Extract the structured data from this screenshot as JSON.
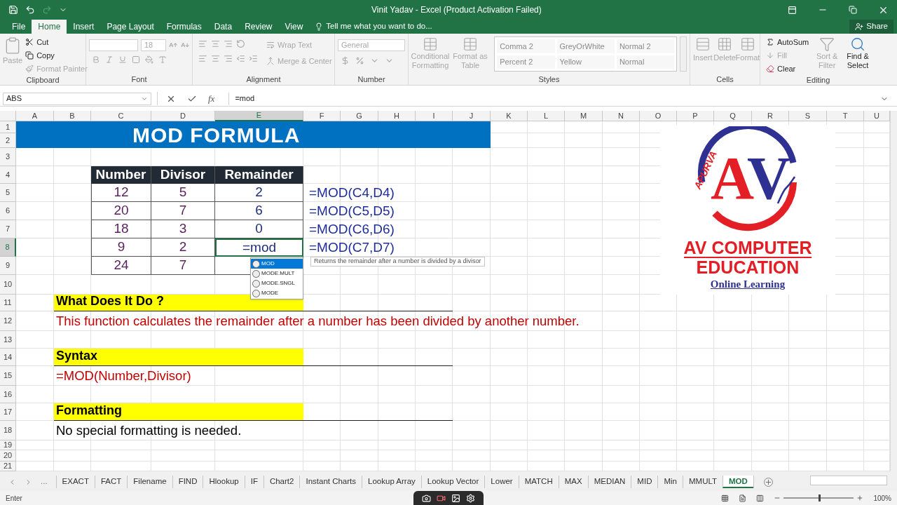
{
  "window": {
    "title": "Vinit Yadav - Excel (Product Activation Failed)"
  },
  "ribbon_tabs": [
    {
      "label": "File",
      "selected": false
    },
    {
      "label": "Home",
      "selected": true
    },
    {
      "label": "Insert",
      "selected": false
    },
    {
      "label": "Page Layout",
      "selected": false
    },
    {
      "label": "Formulas",
      "selected": false
    },
    {
      "label": "Data",
      "selected": false
    },
    {
      "label": "Review",
      "selected": false
    },
    {
      "label": "View",
      "selected": false
    }
  ],
  "tell_me": "Tell me what you want to do...",
  "share": "Share",
  "ribbon": {
    "clipboard": {
      "label": "Clipboard",
      "items": [
        {
          "label": "Paste",
          "disabled": true
        },
        {
          "label": "Cut",
          "disabled": false
        },
        {
          "label": "Copy",
          "disabled": false
        },
        {
          "label": "Format Painter",
          "disabled": true
        }
      ]
    },
    "font": {
      "label": "Font",
      "size": "18"
    },
    "alignment": {
      "label": "Alignment",
      "items": [
        {
          "label": "Wrap Text",
          "disabled": true
        },
        {
          "label": "Merge & Center",
          "disabled": true
        }
      ]
    },
    "number": {
      "label": "Number",
      "format": "General"
    },
    "styles": {
      "label": "Styles",
      "items": [
        {
          "label": "Conditional Formatting",
          "disabled": true
        },
        {
          "label": "Format as Table",
          "disabled": true
        }
      ],
      "gallery": [
        "Comma 2",
        "GreyOrWhite",
        "Normal 2",
        "Percent 2",
        "Yellow",
        "Normal"
      ]
    },
    "cells": {
      "label": "Cells",
      "items": [
        {
          "label": "Insert",
          "disabled": true
        },
        {
          "label": "Delete",
          "disabled": true
        },
        {
          "label": "Format",
          "disabled": true
        }
      ]
    },
    "editing": {
      "label": "Editing",
      "items": [
        {
          "label": "AutoSum",
          "disabled": false
        },
        {
          "label": "Fill",
          "disabled": true
        },
        {
          "label": "Clear",
          "disabled": false
        },
        {
          "label": "Sort & Filter",
          "disabled": true
        },
        {
          "label": "Find & Select",
          "disabled": false
        }
      ]
    }
  },
  "formula_bar": {
    "name_box": "ABS",
    "fx": "fx",
    "formula": "=mod"
  },
  "columns": [
    {
      "label": "A",
      "selected": false
    },
    {
      "label": "B",
      "selected": false
    },
    {
      "label": "C",
      "selected": false
    },
    {
      "label": "D",
      "selected": false
    },
    {
      "label": "E",
      "selected": true
    },
    {
      "label": "F",
      "selected": false
    },
    {
      "label": "G",
      "selected": false
    },
    {
      "label": "H",
      "selected": false
    },
    {
      "label": "I",
      "selected": false
    },
    {
      "label": "J",
      "selected": false
    },
    {
      "label": "K",
      "selected": false
    },
    {
      "label": "L",
      "selected": false
    },
    {
      "label": "M",
      "selected": false
    },
    {
      "label": "N",
      "selected": false
    },
    {
      "label": "O",
      "selected": false
    },
    {
      "label": "P",
      "selected": false
    },
    {
      "label": "Q",
      "selected": false
    },
    {
      "label": "R",
      "selected": false
    },
    {
      "label": "S",
      "selected": false
    },
    {
      "label": "T",
      "selected": false
    },
    {
      "label": "U",
      "selected": false
    }
  ],
  "rows": [
    {
      "label": "1",
      "selected": false
    },
    {
      "label": "2",
      "selected": false
    },
    {
      "label": "3",
      "selected": false
    },
    {
      "label": "4",
      "selected": false
    },
    {
      "label": "5",
      "selected": false
    },
    {
      "label": "6",
      "selected": false
    },
    {
      "label": "7",
      "selected": false
    },
    {
      "label": "8",
      "selected": true
    },
    {
      "label": "9",
      "selected": false
    },
    {
      "label": "10",
      "selected": false
    },
    {
      "label": "11",
      "selected": false
    },
    {
      "label": "12",
      "selected": false
    },
    {
      "label": "13",
      "selected": false
    },
    {
      "label": "14",
      "selected": false
    },
    {
      "label": "15",
      "selected": false
    },
    {
      "label": "16",
      "selected": false
    },
    {
      "label": "17",
      "selected": false
    },
    {
      "label": "18",
      "selected": false
    },
    {
      "label": "19",
      "selected": false
    },
    {
      "label": "20",
      "selected": false
    },
    {
      "label": "21",
      "selected": false
    }
  ],
  "sheet": {
    "title": "MOD FORMULA",
    "table": {
      "columns": [
        "Number",
        "Divisor",
        "Remainder"
      ],
      "rows": [
        {
          "number": "12",
          "divisor": "5",
          "remainder": "2",
          "active": false
        },
        {
          "number": "20",
          "divisor": "7",
          "remainder": "6",
          "active": false
        },
        {
          "number": "18",
          "divisor": "3",
          "remainder": "0",
          "active": false
        },
        {
          "number": "9",
          "divisor": "2",
          "remainder": "=mod",
          "active": true
        },
        {
          "number": "24",
          "divisor": "7",
          "active": false
        }
      ]
    },
    "formulas": [
      "=MOD(C4,D4)",
      "=MOD(C5,D5)",
      "=MOD(C6,D6)",
      "=MOD(C7,D7)"
    ],
    "autocomplete": [
      {
        "label": "MOD",
        "selected": true
      },
      {
        "label": "MODE.MULT",
        "selected": false
      },
      {
        "label": "MODE.SNGL",
        "selected": false
      },
      {
        "label": "MODE",
        "selected": false
      }
    ],
    "tooltip": "Returns the remainder after a number is divided by a divisor",
    "sections": [
      {
        "heading": "What Does It Do ?",
        "body": "This function calculates the remainder after a number has been divided by another number.",
        "color": "#c00000"
      },
      {
        "heading": "Syntax",
        "body": "=MOD(Number,Divisor)",
        "color": "#c00000"
      },
      {
        "heading": "Formatting",
        "body": "No special formatting is needed.",
        "color": "#000000"
      }
    ],
    "logo": {
      "left": "A",
      "right": "V",
      "arc_text": "APURVA",
      "line1": "AV COMPUTER",
      "line2": "EDUCATION",
      "tagline": "Online Learning"
    }
  },
  "sheet_tabs": {
    "more": "...",
    "tabs": [
      {
        "label": "EXACT",
        "selected": false
      },
      {
        "label": "FACT",
        "selected": false
      },
      {
        "label": "Filename",
        "selected": false
      },
      {
        "label": "FIND",
        "selected": false
      },
      {
        "label": "Hlookup",
        "selected": false
      },
      {
        "label": "IF",
        "selected": false
      },
      {
        "label": "Chart2",
        "selected": false
      },
      {
        "label": "Instant Charts",
        "selected": false
      },
      {
        "label": "Lookup Array",
        "selected": false
      },
      {
        "label": "Lookup Vector",
        "selected": false
      },
      {
        "label": "Lower",
        "selected": false
      },
      {
        "label": "MATCH",
        "selected": false
      },
      {
        "label": "MAX",
        "selected": false
      },
      {
        "label": "MEDIAN",
        "selected": false
      },
      {
        "label": "MID",
        "selected": false
      },
      {
        "label": "Min",
        "selected": false
      },
      {
        "label": "MMULT",
        "selected": false
      },
      {
        "label": "MOD",
        "selected": true
      }
    ]
  },
  "status_bar": {
    "mode": "Enter",
    "zoom": {
      "label": "100%",
      "level": 0.5
    }
  }
}
